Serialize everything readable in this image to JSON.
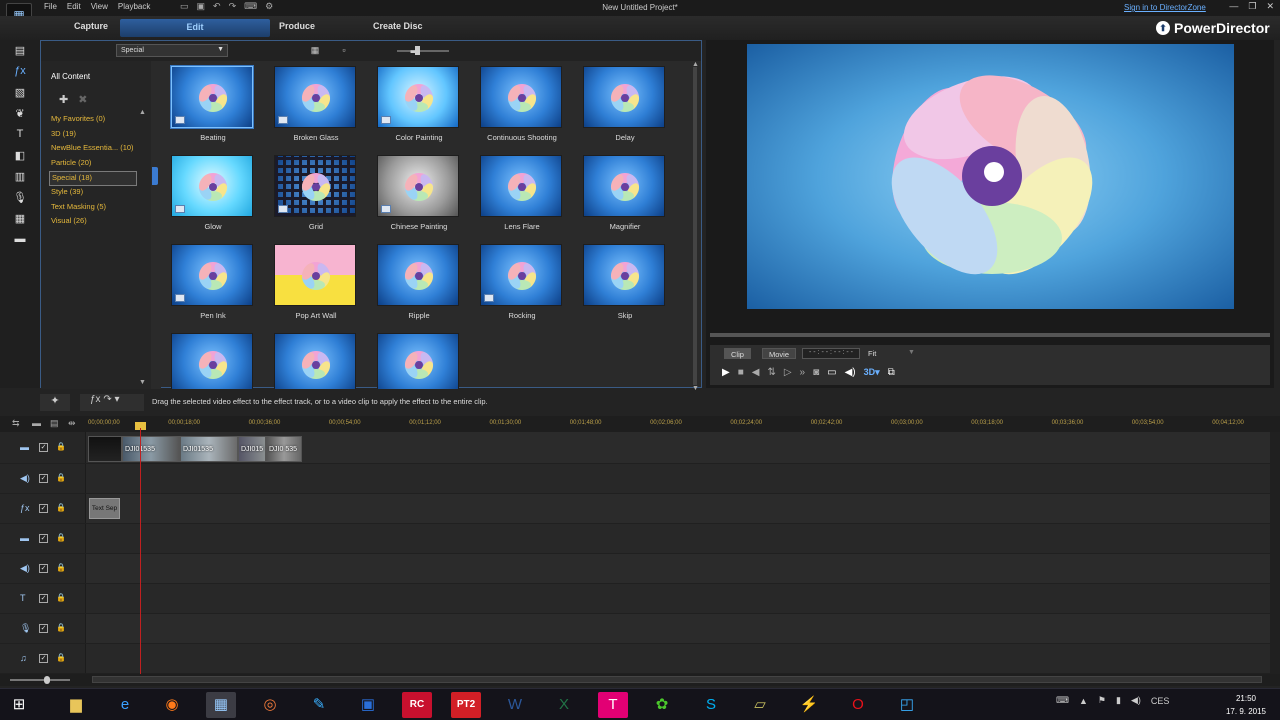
{
  "window": {
    "title": "New Untitled Project*",
    "sign_in": "Sign in to DirectorZone",
    "brand": "PowerDirector",
    "menu": [
      "File",
      "Edit",
      "View",
      "Playback"
    ]
  },
  "modes": [
    "Capture",
    "Edit",
    "Produce",
    "Create Disc"
  ],
  "library": {
    "filter": "Special",
    "tree_title": "All Content",
    "categories": [
      "My Favorites  (0)",
      "3D  (19)",
      "NewBlue Essentia...  (10)",
      "Particle  (20)",
      "Special  (18)",
      "Style  (39)",
      "Text Masking  (5)",
      "Visual  (26)"
    ],
    "effects": [
      "Beating",
      "Broken Glass",
      "Color Painting",
      "Continuous Shooting",
      "Delay",
      "Glow",
      "Grid",
      "Chinese Painting",
      "Lens Flare",
      "Magnifier",
      "Pen Ink",
      "Pop Art Wall",
      "Ripple",
      "Rocking",
      "Skip",
      "",
      "",
      ""
    ]
  },
  "preview": {
    "clip_btn": "Clip",
    "movie_btn": "Movie",
    "timecode": "- - : - - : - - : - -",
    "fit": "Fit"
  },
  "hint": "Drag the selected video effect to the effect track, or to a video clip to apply the effect to the entire clip.",
  "timeline": {
    "ruler": [
      "00;00;00;00",
      "00;00;18;00",
      "00;00;36;00",
      "00;00;54;00",
      "00;01;12;00",
      "00;01;30;00",
      "00;01;48;00",
      "00;02;06;00",
      "00;02;24;00",
      "00;02;42;00",
      "00;03;00;00",
      "00;03;18;00",
      "00;03;36;00",
      "00;03;54;00",
      "00;04;12;00"
    ],
    "clips": [
      "DJI01535",
      "DJI01535",
      "DJI015",
      "DJI0 535"
    ],
    "fx_clip": "Text Sep"
  },
  "taskbar": {
    "lang": "CES",
    "time": "21:50",
    "date": "17. 9. 2015"
  }
}
